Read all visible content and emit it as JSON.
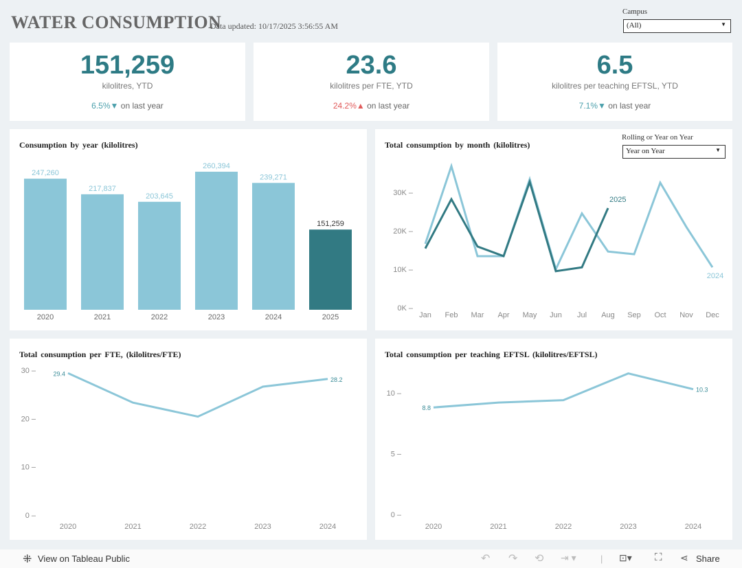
{
  "header": {
    "title": "WATER CONSUMPTION",
    "updated": "Data updated: 10/17/2025 3:56:55 AM",
    "campus_label": "Campus",
    "campus_value": "(All)"
  },
  "kpis": [
    {
      "value": "151,259",
      "label": "kilolitres, YTD",
      "change": "6.5%",
      "direction": "down",
      "suffix": "on last year",
      "color": "#4a9fab"
    },
    {
      "value": "23.6",
      "label": "kilolitres per FTE, YTD",
      "change": "24.2%",
      "direction": "up",
      "suffix": "on last year",
      "color": "#e05a5a"
    },
    {
      "value": "6.5",
      "label": "kilolitres per teaching EFTSL, YTD",
      "change": "7.1%",
      "direction": "down",
      "suffix": "on last year",
      "color": "#4a9fab"
    }
  ],
  "colors": {
    "light": "#8bc6d8",
    "dark": "#327a83"
  },
  "rolling": {
    "label": "Rolling or Year on Year",
    "value": "Year on Year"
  },
  "chart_data": [
    {
      "type": "bar",
      "title": "Consumption by year (kilolitres)",
      "categories": [
        "2020",
        "2021",
        "2022",
        "2023",
        "2024",
        "2025"
      ],
      "values": [
        247260,
        217837,
        203645,
        260394,
        239271,
        151259
      ],
      "labels": [
        "247,260",
        "217,837",
        "203,645",
        "260,394",
        "239,271",
        "151,259"
      ],
      "highlight": "2025"
    },
    {
      "type": "line",
      "title": "Total consumption by month (kilolitres)",
      "categories": [
        "Jan",
        "Feb",
        "Mar",
        "Apr",
        "May",
        "Jun",
        "Jul",
        "Aug",
        "Sep",
        "Oct",
        "Nov",
        "Dec"
      ],
      "yticks": [
        "0K",
        "10K",
        "20K",
        "30K"
      ],
      "ylim": [
        0,
        38000
      ],
      "series": [
        {
          "name": "2024",
          "values": [
            16600,
            36800,
            13400,
            13400,
            33400,
            10000,
            24500,
            14600,
            13900,
            32500,
            21000,
            10500
          ]
        },
        {
          "name": "2025",
          "values": [
            15400,
            28200,
            15900,
            13400,
            32700,
            9500,
            10500,
            25900
          ]
        }
      ]
    },
    {
      "type": "line",
      "title": "Total consumption per FTE, (kilolitres/FTE)",
      "categories": [
        "2020",
        "2021",
        "2022",
        "2023",
        "2024"
      ],
      "values": [
        29.4,
        23.3,
        20.4,
        26.6,
        28.2
      ],
      "yticks": [
        "0",
        "10",
        "20",
        "30"
      ],
      "ylim": [
        0,
        30
      ],
      "end_labels": [
        "29.4",
        "28.2"
      ]
    },
    {
      "type": "line",
      "title": "Total consumption per teaching EFTSL (kilolitres/EFTSL)",
      "categories": [
        "2020",
        "2021",
        "2022",
        "2023",
        "2024"
      ],
      "values": [
        8.8,
        9.2,
        9.4,
        11.6,
        10.3
      ],
      "yticks": [
        "0",
        "5",
        "10"
      ],
      "ylim": [
        0,
        10
      ],
      "end_labels": [
        "8.8",
        "10.3"
      ]
    }
  ],
  "footer": {
    "view_label": "View on Tableau Public",
    "share_label": "Share"
  }
}
